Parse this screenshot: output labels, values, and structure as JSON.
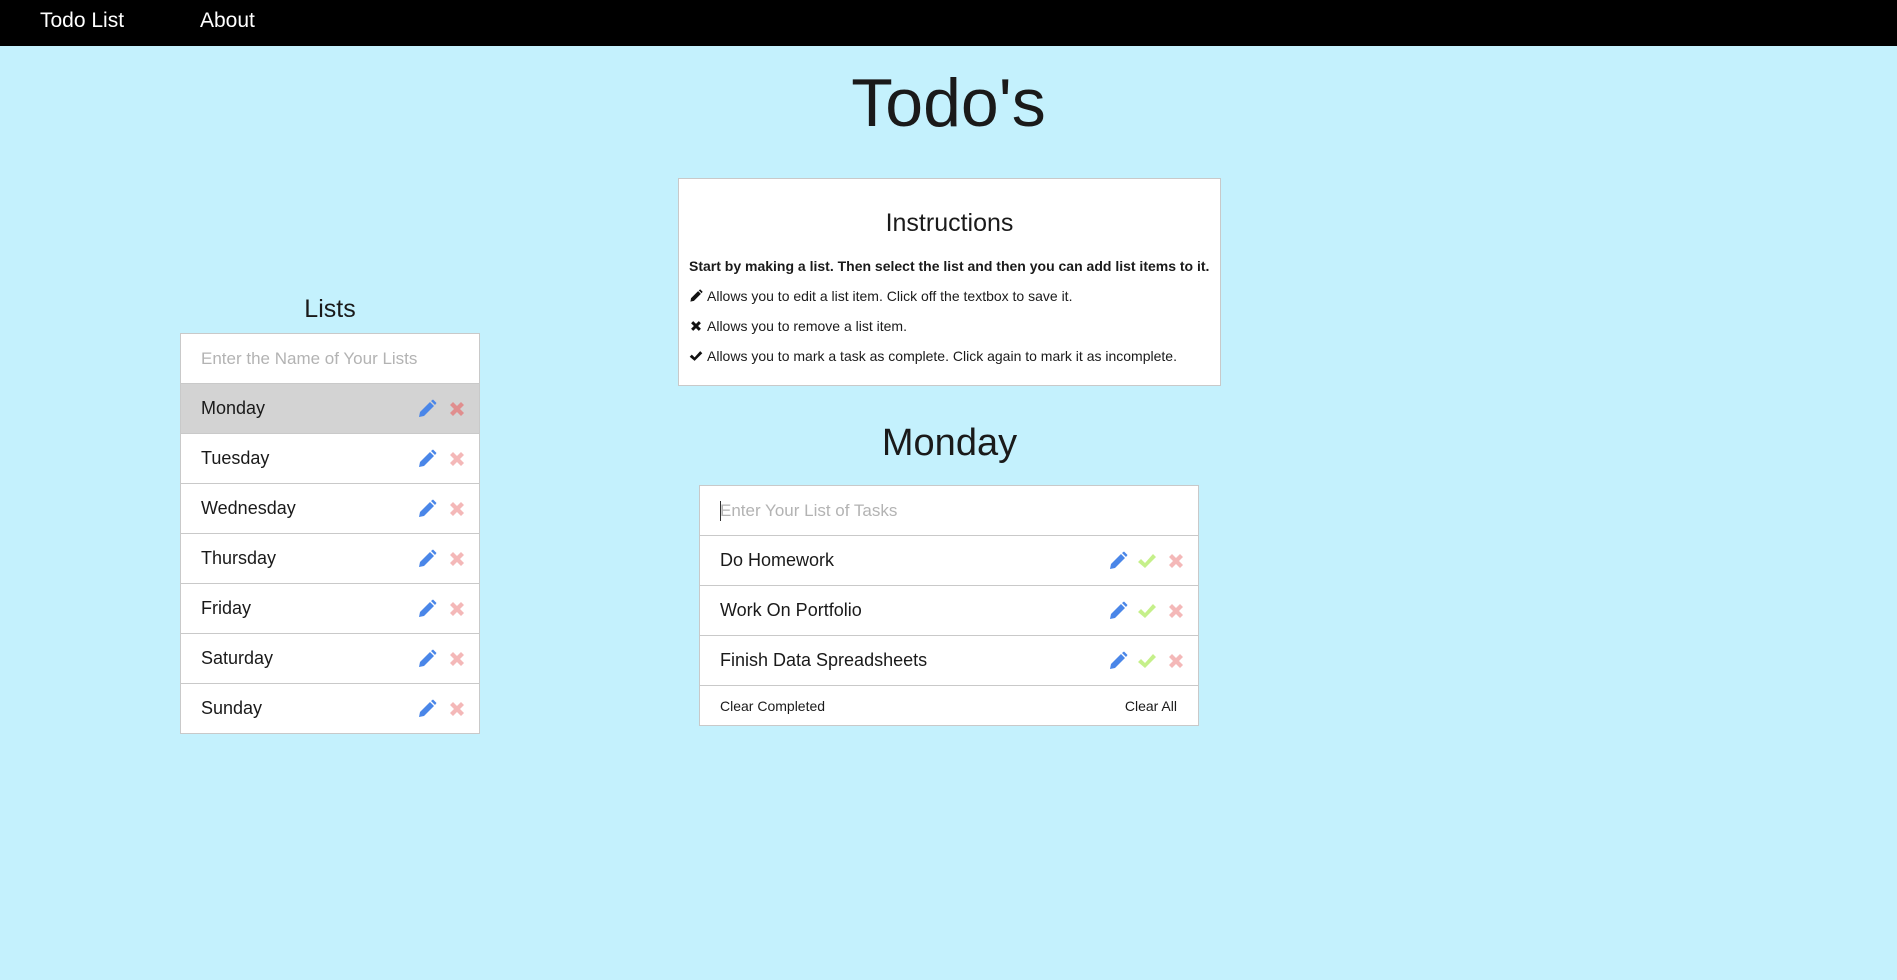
{
  "nav": {
    "brand": "Todo List",
    "about": "About"
  },
  "page": {
    "title": "Todo's"
  },
  "instructions": {
    "title": "Instructions",
    "intro": "Start by making a list. Then select the list and then you can add list items to it.",
    "edit_text": "Allows you to edit a list item. Click off the textbox to save it.",
    "remove_text": "Allows you to remove a list item.",
    "complete_text": "Allows you to mark a task as complete. Click again to mark it as incomplete."
  },
  "lists": {
    "heading": "Lists",
    "placeholder": "Enter the Name of Your Lists",
    "items": [
      {
        "label": "Monday",
        "selected": true
      },
      {
        "label": "Tuesday",
        "selected": false
      },
      {
        "label": "Wednesday",
        "selected": false
      },
      {
        "label": "Thursday",
        "selected": false
      },
      {
        "label": "Friday",
        "selected": false
      },
      {
        "label": "Saturday",
        "selected": false
      },
      {
        "label": "Sunday",
        "selected": false
      }
    ]
  },
  "tasks": {
    "heading": "Monday",
    "placeholder": "Enter Your List of Tasks",
    "items": [
      {
        "label": "Do Homework"
      },
      {
        "label": "Work On Portfolio"
      },
      {
        "label": "Finish Data Spreadsheets"
      }
    ],
    "clear_completed": "Clear Completed",
    "clear_all": "Clear All"
  },
  "colors": {
    "background": "#c4f1fd",
    "navbar": "#000000",
    "selected_row": "#d3d3d3",
    "edit_icon": "#4a86e8",
    "remove_icon": "#f4b8b8",
    "remove_icon_selected": "#e08e8e",
    "check_icon": "#c5f08a"
  },
  "icons": {
    "edit": "pencil-icon",
    "remove": "x-icon",
    "complete": "check-icon"
  }
}
